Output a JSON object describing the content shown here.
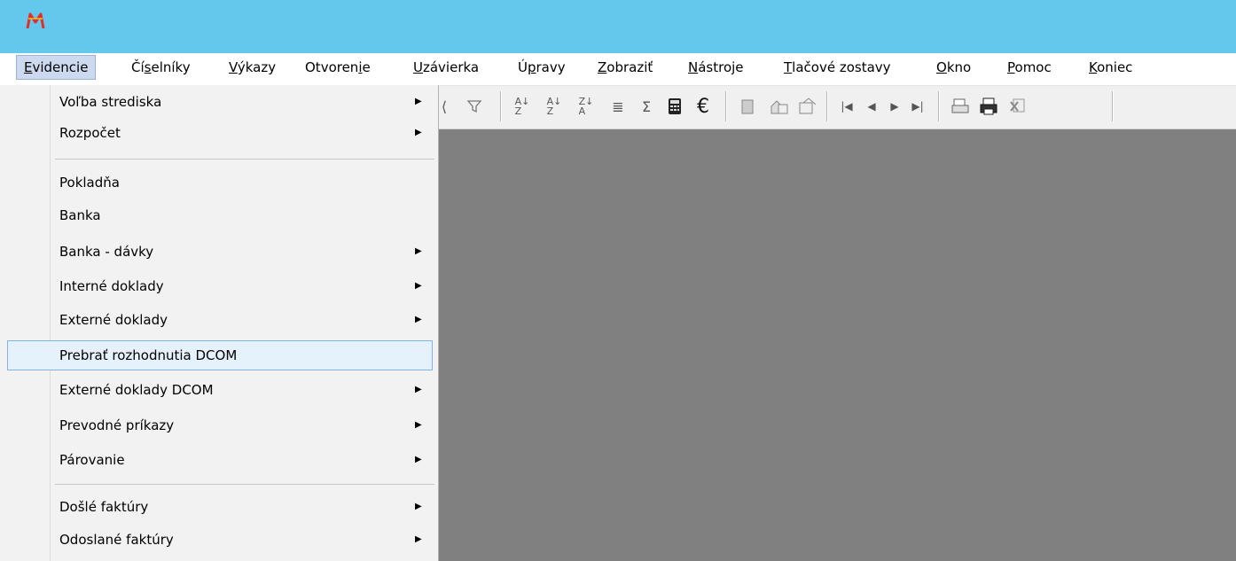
{
  "menubar": {
    "items": [
      {
        "label": "Evidencie",
        "underline": "E",
        "rest": "videncie"
      },
      {
        "label": "Číselníky",
        "underline": "s",
        "pre": "Čí",
        "rest": "elníky"
      },
      {
        "label": "Výkazy",
        "underline": "V",
        "rest": "ýkazy"
      },
      {
        "label": "Otvorenie",
        "pre": "Otvoren",
        "underline": "i",
        "rest": "e"
      },
      {
        "label": "Uzávierka",
        "underline": "U",
        "rest": "závierka"
      },
      {
        "label": "Úpravy",
        "pre": "Ú",
        "underline": "p",
        "rest": "ravy"
      },
      {
        "label": "Zobraziť",
        "underline": "Z",
        "rest": "obraziť"
      },
      {
        "label": "Nástroje",
        "underline": "N",
        "rest": "ástroje"
      },
      {
        "label": "Tlačové zostavy",
        "underline": "T",
        "rest": "lačové zostavy"
      },
      {
        "label": "Okno",
        "underline": "O",
        "rest": "kno"
      },
      {
        "label": "Pomoc",
        "underline": "P",
        "rest": "omoc"
      },
      {
        "label": "Koniec",
        "underline": "K",
        "rest": "oniec"
      }
    ]
  },
  "dropdown": {
    "items": [
      {
        "label": "Voľba strediska",
        "submenu": true
      },
      {
        "label": "Rozpočet",
        "submenu": true
      },
      {
        "label": "Pokladňa",
        "submenu": false
      },
      {
        "label": "Banka",
        "submenu": false
      },
      {
        "label": "Banka - dávky",
        "submenu": true
      },
      {
        "label": "Interné doklady",
        "submenu": true
      },
      {
        "label": "Externé doklady",
        "submenu": true
      },
      {
        "label": "Prebrať rozhodnutia DCOM",
        "submenu": false,
        "highlighted": true
      },
      {
        "label": "Externé doklady DCOM",
        "submenu": true
      },
      {
        "label": "Prevodné príkazy",
        "submenu": true
      },
      {
        "label": "Párovanie",
        "submenu": true
      },
      {
        "label": "Došlé faktúry",
        "submenu": true
      },
      {
        "label": "Odoslané faktúry",
        "submenu": true
      }
    ],
    "arrow_glyph": "▶"
  },
  "toolbar": {
    "icons": [
      "sort-asc-icon",
      "sort-desc-icon",
      "sort-za-icon",
      "columns-icon",
      "sum-icon",
      "calculator-icon",
      "euro-icon",
      "clipboard-icon",
      "export-icon",
      "properties-icon",
      "first-record-icon",
      "prev-record-icon",
      "next-record-icon",
      "last-record-icon",
      "print-preview-icon",
      "print-icon",
      "excel-icon"
    ],
    "euro_glyph": "€",
    "sum_glyph": "Σ"
  },
  "colors": {
    "titlebar": "#64c8ec",
    "workspace": "#808080",
    "logo": "#e0302a",
    "menu_highlight": "#e5f1fb"
  }
}
